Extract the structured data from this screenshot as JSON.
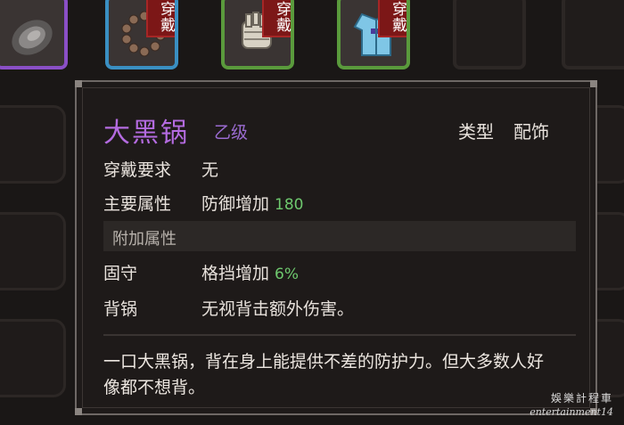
{
  "equipped_slots": [
    {
      "item": "wok-icon",
      "badge": ""
    },
    {
      "item": "prayer-beads-icon",
      "badge": "穿戴"
    },
    {
      "item": "bandage-glove-icon",
      "badge": "穿戴"
    },
    {
      "item": "robe-icon",
      "badge": "穿戴"
    }
  ],
  "tooltip": {
    "name": "大黑锅",
    "grade": "乙级",
    "type_label": "类型",
    "type_value": "配饰",
    "requirement_label": "穿戴要求",
    "requirement_value": "无",
    "main_attr_label": "主要属性",
    "main_attr_name": "防御增加",
    "main_attr_value": "180",
    "extra_header": "附加属性",
    "extra_1_label": "固守",
    "extra_1_name": "格挡增加",
    "extra_1_value": "6%",
    "extra_2_label": "背锅",
    "extra_2_desc": "无视背击额外伤害。",
    "description": "一口大黑锅，背在身上能提供不差的防护力。但大多数人好像都不想背。"
  },
  "watermark": {
    "line1": "娛樂計程車",
    "line2": "entertainment14"
  },
  "colors": {
    "item_name": "#b46be0",
    "grade": "#9a6bd0",
    "positive_value": "#6ec86e",
    "badge": "#7c1717"
  }
}
